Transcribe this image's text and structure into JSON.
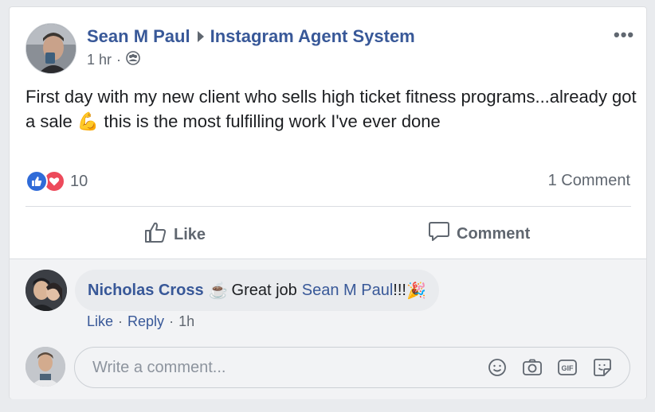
{
  "post": {
    "author": "Sean M Paul",
    "group": "Instagram Agent System",
    "time": "1 hr",
    "dot": "·",
    "more": "•••",
    "text_before_emoji": "First day with my new client who sells high ticket fitness programs...already got a sale",
    "emoji": "💪",
    "text_after_emoji": "this is the most fulfilling work I've ever done",
    "reaction_count": "10",
    "comment_count": "1 Comment"
  },
  "actions": {
    "like": "Like",
    "comment": "Comment"
  },
  "comment": {
    "author": "Nicholas Cross",
    "badge_emoji": "☕",
    "text": "Great job",
    "mention": "Sean M Paul",
    "suffix": "!!!",
    "end_emoji": "🎉",
    "like": "Like",
    "reply": "Reply",
    "sep": "·",
    "time": "1h"
  },
  "composer": {
    "placeholder": "Write a comment..."
  },
  "colors": {
    "link": "#385898",
    "muted": "#606770",
    "like_blue": "#2f6bd8",
    "love_red": "#ed4a5b"
  }
}
